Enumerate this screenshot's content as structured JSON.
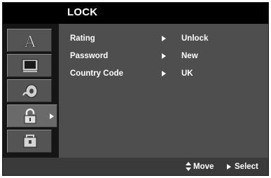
{
  "header": {
    "title": "LOCK"
  },
  "sidebar": {
    "tabs": [
      {
        "icon": "language-a-icon",
        "active": false
      },
      {
        "icon": "display-icon",
        "active": false
      },
      {
        "icon": "audio-disc-icon",
        "active": false
      },
      {
        "icon": "lock-icon",
        "active": true
      },
      {
        "icon": "others-icon",
        "active": false
      }
    ]
  },
  "menu": {
    "rows": [
      {
        "label": "Rating",
        "value": "Unlock"
      },
      {
        "label": "Password",
        "value": "New"
      },
      {
        "label": "Country Code",
        "value": "UK"
      }
    ]
  },
  "footer": {
    "move_label": "Move",
    "select_label": "Select"
  },
  "colors": {
    "panel": "#4e4e4e",
    "sidebar": "#151515",
    "tab": "#545454",
    "text": "#ffffff"
  }
}
